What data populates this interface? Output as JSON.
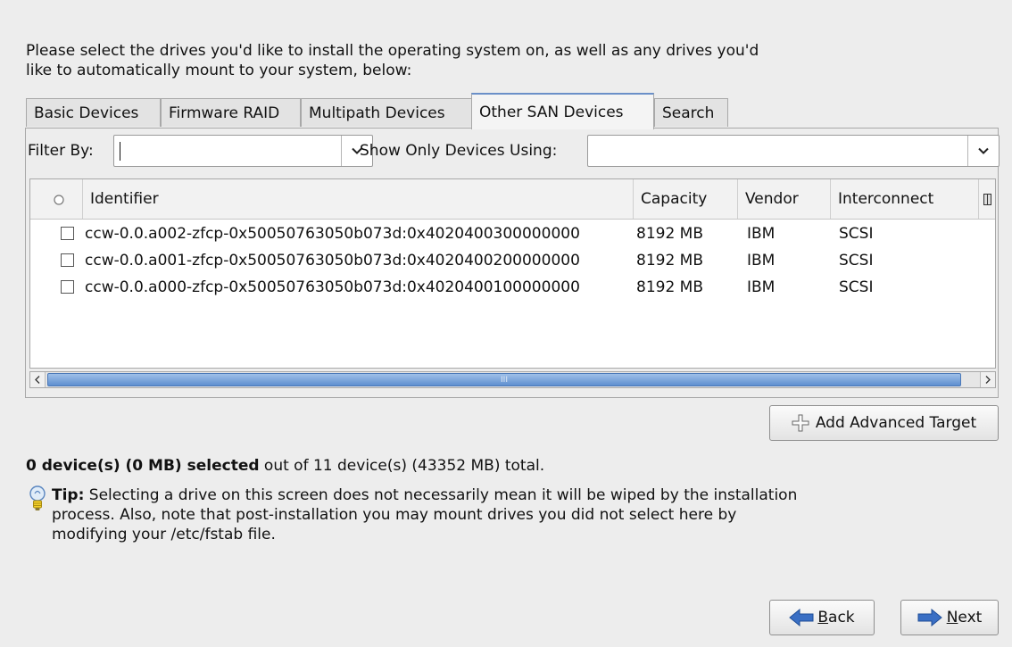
{
  "intro_text": "Please select the drives you'd like to install the operating system on, as well as any drives you'd like to automatically mount to your system, below:",
  "tabs": [
    {
      "label": "Basic Devices",
      "active": false
    },
    {
      "label": "Firmware RAID",
      "active": false
    },
    {
      "label": "Multipath Devices",
      "active": false
    },
    {
      "label": "Other SAN Devices",
      "active": true
    },
    {
      "label": "Search",
      "active": false
    }
  ],
  "filter": {
    "filter_by_label": "Filter By:",
    "filter_by_value": "",
    "show_only_label": "Show Only Devices Using:",
    "show_only_value": ""
  },
  "table": {
    "columns": [
      "Identifier",
      "Capacity",
      "Vendor",
      "Interconnect"
    ],
    "rows": [
      {
        "checked": false,
        "identifier": "ccw-0.0.a002-zfcp-0x50050763050b073d:0x4020400300000000",
        "capacity": "8192 MB",
        "vendor": "IBM",
        "interconnect": "SCSI"
      },
      {
        "checked": false,
        "identifier": "ccw-0.0.a001-zfcp-0x50050763050b073d:0x4020400200000000",
        "capacity": "8192 MB",
        "vendor": "IBM",
        "interconnect": "SCSI"
      },
      {
        "checked": false,
        "identifier": "ccw-0.0.a000-zfcp-0x50050763050b073d:0x4020400100000000",
        "capacity": "8192 MB",
        "vendor": "IBM",
        "interconnect": "SCSI"
      }
    ]
  },
  "scroll_thumb_grip": "III",
  "add_target_label": "Add Advanced Target",
  "summary": {
    "selected_bold": "0 device(s) (0 MB) selected",
    "rest": " out of 11 device(s) (43352 MB) total."
  },
  "tip": {
    "bold": "Tip:",
    "text": " Selecting a drive on this screen does not necessarily mean it will be wiped by the installation process.  Also, note that post-installation you may mount drives you did not select here by modifying your /etc/fstab file."
  },
  "nav": {
    "back_label": "Back",
    "back_mnemonic": "B",
    "back_rest": "ack",
    "next_label": "Next",
    "next_mnemonic": "N",
    "next_rest": "ext"
  },
  "colors": {
    "background": "#ededed",
    "accent": "#3a6fc4",
    "scroll_thumb": "#5f8fd0"
  },
  "icons": {
    "add_target": "plus-icon",
    "tip": "lightbulb-icon",
    "back": "arrow-left-icon",
    "next": "arrow-right-icon"
  }
}
